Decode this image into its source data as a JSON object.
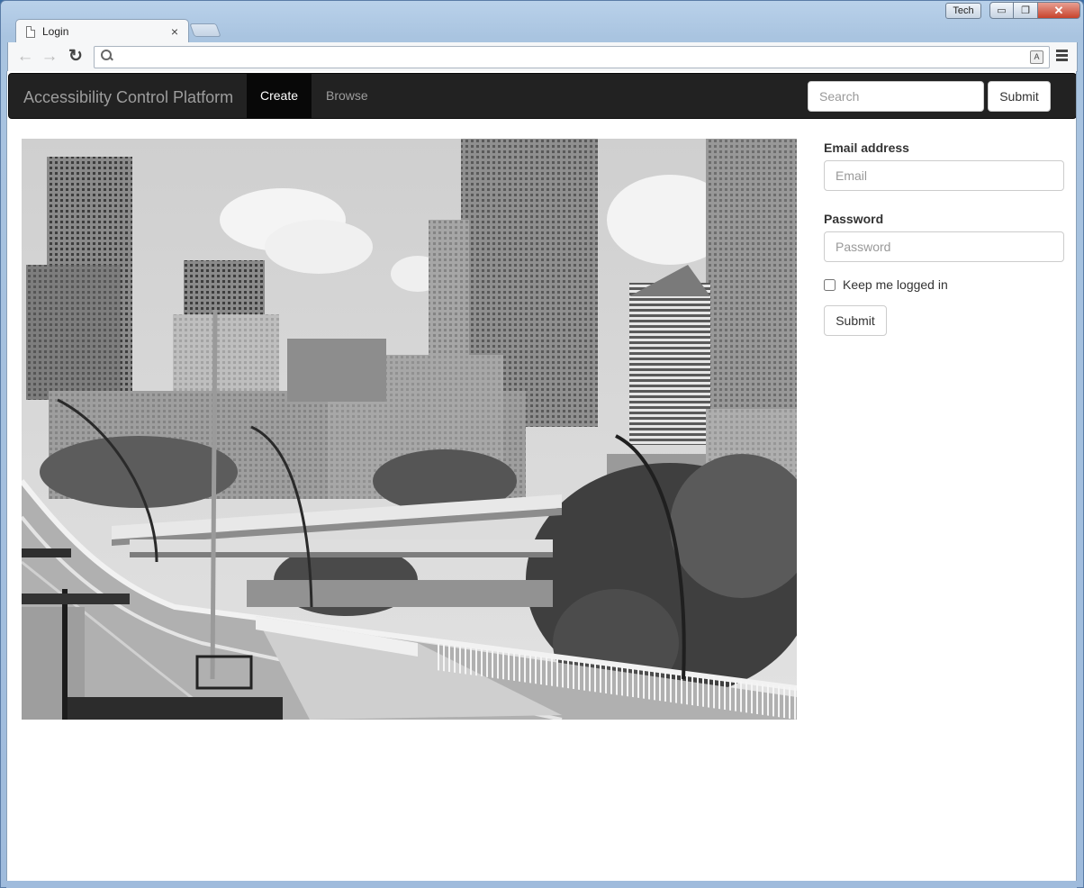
{
  "window": {
    "user_badge": "Tech",
    "minimize": "▭",
    "maximize": "❐",
    "close": "✕"
  },
  "tab": {
    "title": "Login",
    "close": "×"
  },
  "toolbar": {
    "back": "←",
    "forward": "→",
    "reload": "↻",
    "address_value": ""
  },
  "navbar": {
    "brand": "Accessibility Control Platform",
    "links": [
      {
        "label": "Create",
        "active": true
      },
      {
        "label": "Browse",
        "active": false
      }
    ],
    "search_placeholder": "Search",
    "submit_label": "Submit"
  },
  "login_form": {
    "email_label": "Email address",
    "email_placeholder": "Email",
    "password_label": "Password",
    "password_placeholder": "Password",
    "remember_label": "Keep me logged in",
    "remember_checked": false,
    "submit_label": "Submit"
  },
  "photo": {
    "subject": "grayscale-city-skyline-bridge"
  }
}
